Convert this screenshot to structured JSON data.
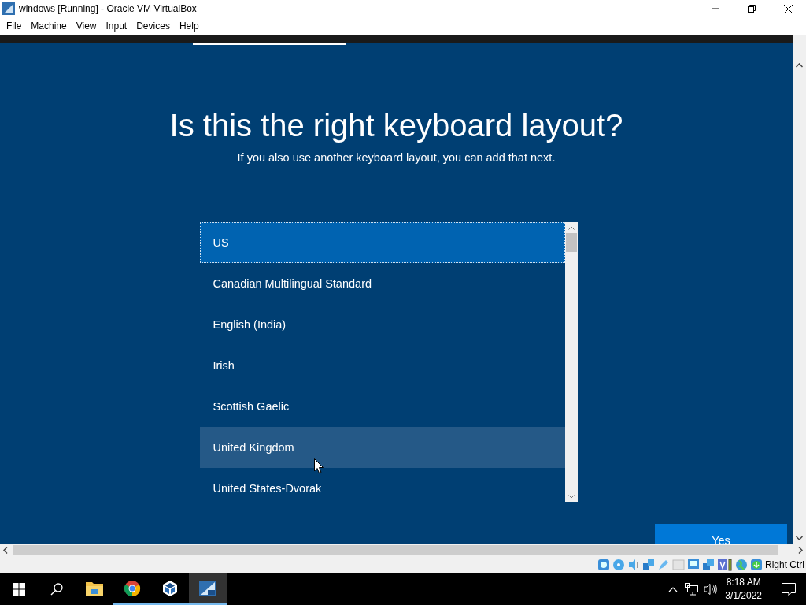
{
  "window": {
    "title": "windows [Running] - Oracle VM VirtualBox"
  },
  "menu": [
    "File",
    "Machine",
    "View",
    "Input",
    "Devices",
    "Help"
  ],
  "setup": {
    "heading": "Is this the right keyboard layout?",
    "subheading": "If you also use another keyboard layout, you can add that next.",
    "layouts": [
      {
        "label": "US",
        "selected": true,
        "hovered": false
      },
      {
        "label": "Canadian Multilingual Standard",
        "selected": false,
        "hovered": false
      },
      {
        "label": "English (India)",
        "selected": false,
        "hovered": false
      },
      {
        "label": "Irish",
        "selected": false,
        "hovered": false
      },
      {
        "label": "Scottish Gaelic",
        "selected": false,
        "hovered": false
      },
      {
        "label": "United Kingdom",
        "selected": false,
        "hovered": true
      },
      {
        "label": "United States-Dvorak",
        "selected": false,
        "hovered": false
      }
    ],
    "yes_button": "Yes"
  },
  "status_bar": {
    "host_key": "Right Ctrl"
  },
  "taskbar": {
    "apps": [
      {
        "kind": "explorer",
        "running": false,
        "selected": false
      },
      {
        "kind": "chrome",
        "running": true,
        "selected": false
      },
      {
        "kind": "virtualbox",
        "running": true,
        "selected": false
      },
      {
        "kind": "vm",
        "running": true,
        "selected": true
      }
    ],
    "time": "8:18 AM",
    "date": "3/1/2022"
  }
}
